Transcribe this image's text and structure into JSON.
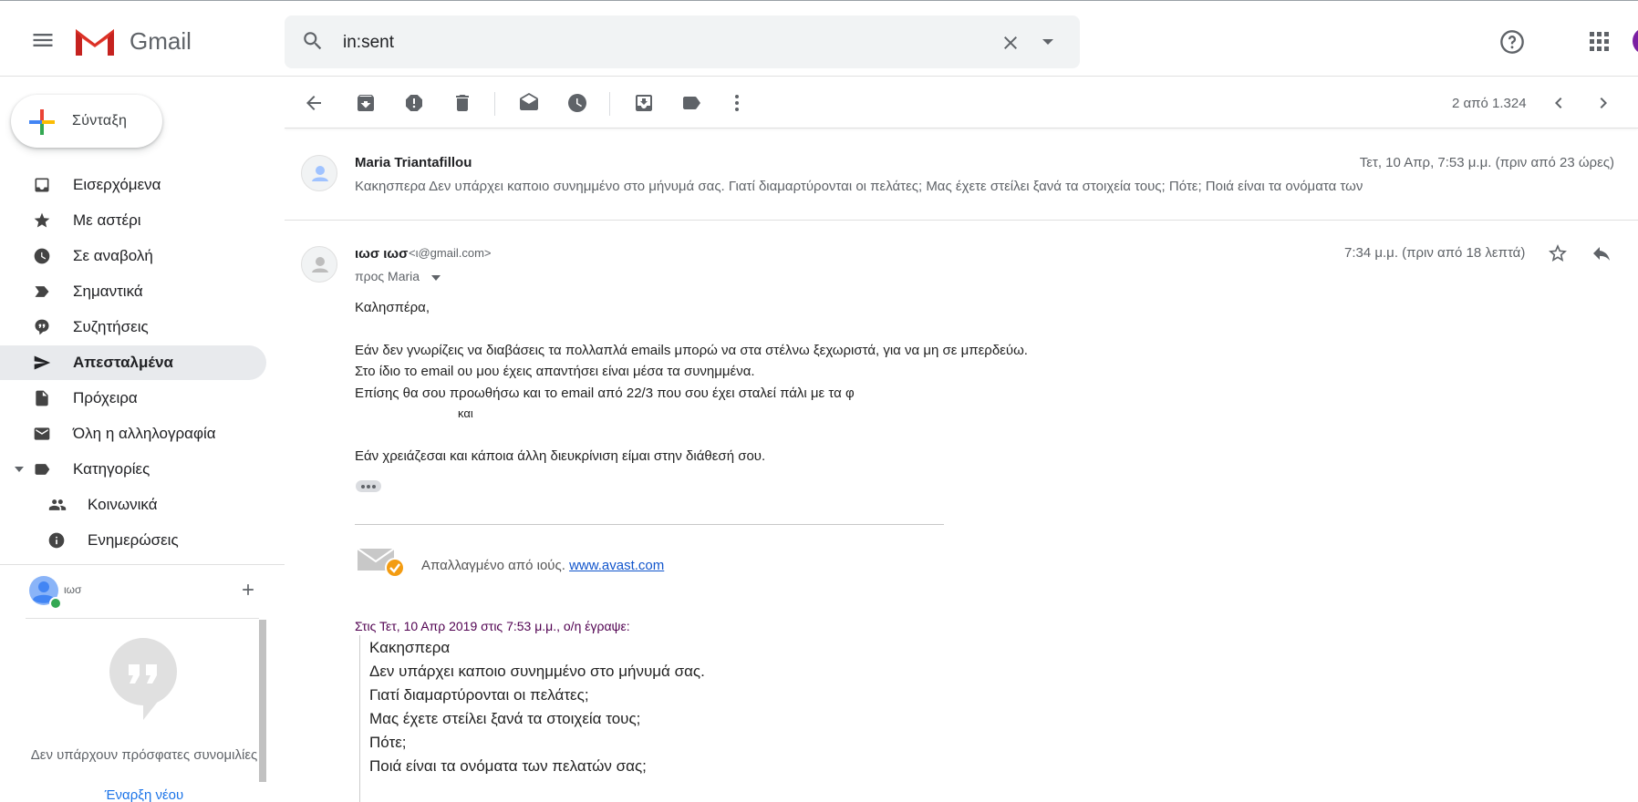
{
  "header": {
    "app_name": "Gmail",
    "search_value": "in:sent"
  },
  "toolbar": {
    "page_count": "2 από 1.324"
  },
  "compose": {
    "label": "Σύνταξη"
  },
  "nav": {
    "items": [
      {
        "label": "Εισερχόμενα",
        "icon": "inbox-icon"
      },
      {
        "label": "Με αστέρι",
        "icon": "star-icon"
      },
      {
        "label": "Σε αναβολή",
        "icon": "clock-icon"
      },
      {
        "label": "Σημαντικά",
        "icon": "important-icon"
      },
      {
        "label": "Συζητήσεις",
        "icon": "chat-icon"
      },
      {
        "label": "Απεσταλμένα",
        "icon": "send-icon"
      },
      {
        "label": "Πρόχειρα",
        "icon": "draft-icon"
      },
      {
        "label": "Όλη η αλληλογραφία",
        "icon": "mail-icon"
      },
      {
        "label": "Κατηγορίες",
        "icon": "label-icon"
      }
    ],
    "sub_items": [
      {
        "label": "Κοινωνικά",
        "icon": "people-icon"
      },
      {
        "label": "Ενημερώσεις",
        "icon": "info-icon"
      }
    ]
  },
  "hangouts": {
    "user_name": "ιωσ",
    "empty_text": "Δεν υπάρχουν πρόσφατες συνομιλίες",
    "start_new": "Έναρξη νέου"
  },
  "message1": {
    "sender": "Maria Triantafillou",
    "date": "Τετ, 10 Απρ, 7:53 μ.μ. (πριν από 23 ώρες)",
    "snippet": "Κακησπερα Δεν υπάρχει καποιο συνημμένο στο μήνυμά σας. Γιατί διαμαρτύρονται οι πελάτες; Μας έχετε στείλει ξανά τα στοιχεία τους; Πότε; Ποιά είναι τα ονόματα των"
  },
  "message2": {
    "sender": "ιωσ ιωσ",
    "email": "<ι@gmail.com>",
    "date": "7:34 μ.μ. (πριν από 18 λεπτά)",
    "to": "προς Maria",
    "body": [
      "Καλησπέρα,",
      "Εάν δεν γνωρίζεις να διαβάσεις τα πολλαπλά emails μπορώ να στα στέλνω ξεχωριστά, για να μη σε μπερδεύω.",
      "Στο ίδιο το email ου μου έχεις απαντήσει είναι μέσα τα συνημμένα.",
      "Επίσης θα σου προωθήσω και το email από 22/3 που σου έχει σταλεί πάλι με τα φ",
      "και",
      "Εάν χρειάζεσαι και κάποια άλλη διευκρίνιση είμαι στην διάθεσή σου."
    ],
    "avast_text": "Απαλλαγμένο από ιούς.",
    "avast_link": "www.avast.com",
    "quote_attribution": "Στις Τετ, 10 Απρ 2019 στις 7:53 μ.μ., ο/η έγραψε:",
    "quoted": [
      "Κακησπερα",
      "Δεν υπάρχει καποιο συνημμένο στο μήνυμά σας.",
      "Γιατί διαμαρτύρονται οι πελάτες;",
      "Μας έχετε στείλει ξανά τα στοιχεία τους;",
      "Πότε;",
      "Ποιά είναι τα ονόματα των πελατών σας;"
    ]
  },
  "colors": {
    "gmail_red": "#ea4335",
    "link": "#1155cc",
    "active_nav": "#e8eaed",
    "quote_attr": "#500050"
  }
}
